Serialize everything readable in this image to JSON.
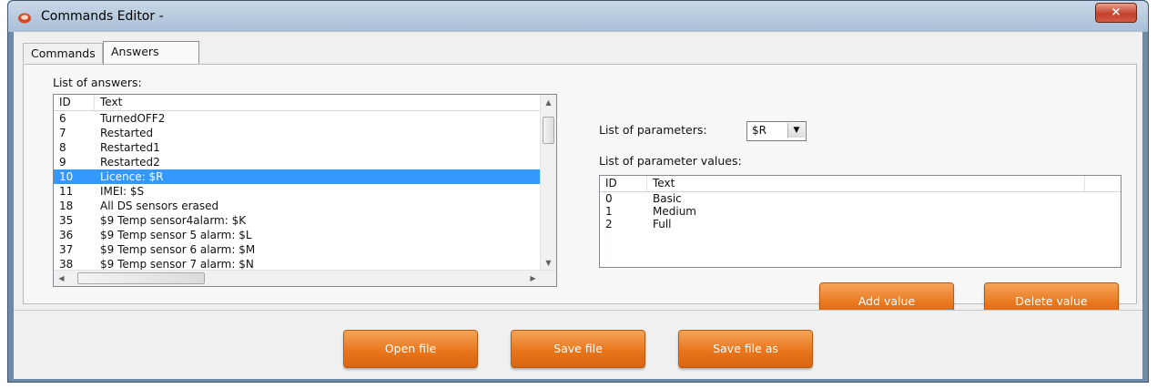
{
  "window": {
    "title": "Commands Editor -",
    "close_glyph": "×"
  },
  "tabs": [
    {
      "label": "Commands",
      "active": false
    },
    {
      "label": "Answers",
      "active": true
    }
  ],
  "answers": {
    "label": "List of answers:",
    "columns": [
      "ID",
      "Text"
    ],
    "rows": [
      {
        "id": "6",
        "text": "TurnedOFF2"
      },
      {
        "id": "7",
        "text": "Restarted"
      },
      {
        "id": "8",
        "text": "Restarted1"
      },
      {
        "id": "9",
        "text": "Restarted2"
      },
      {
        "id": "10",
        "text": "Licence: $R",
        "selected": true
      },
      {
        "id": "11",
        "text": "IMEI: $S"
      },
      {
        "id": "18",
        "text": "All DS sensors erased"
      },
      {
        "id": "35",
        "text": "$9 Temp sensor4alarm: $K"
      },
      {
        "id": "36",
        "text": "$9 Temp sensor 5 alarm: $L"
      },
      {
        "id": "37",
        "text": "$9 Temp sensor 6 alarm: $M"
      },
      {
        "id": "38",
        "text": "$9 Temp sensor 7 alarm: $N"
      }
    ]
  },
  "parameters": {
    "label": "List of parameters:",
    "selected": "$R"
  },
  "parameter_values": {
    "label": "List of parameter values:",
    "columns": [
      "ID",
      "Text"
    ],
    "rows": [
      {
        "id": "0",
        "text": "Basic"
      },
      {
        "id": "1",
        "text": "Medium"
      },
      {
        "id": "2",
        "text": "Full"
      }
    ]
  },
  "buttons": {
    "add_value": "Add value",
    "delete_value": "Delete value",
    "open_file": "Open file",
    "save_file": "Save file",
    "save_file_as": "Save file as"
  },
  "colors": {
    "accent": "#e9761c",
    "selection": "#3399ff"
  },
  "icons": [
    "app-icon",
    "close-icon",
    "chevron-down-icon",
    "scroll-up-icon",
    "scroll-down-icon",
    "scroll-left-icon",
    "scroll-right-icon"
  ]
}
